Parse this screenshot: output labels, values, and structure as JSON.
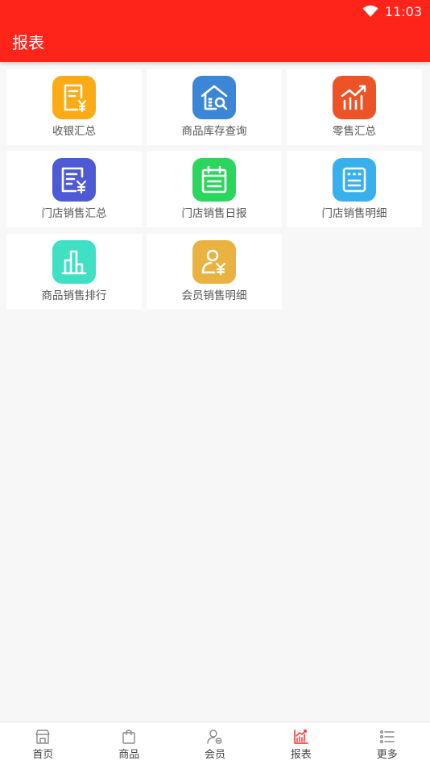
{
  "status_bar": {
    "time": "11:03",
    "wifi_icon": "wifi-icon"
  },
  "header": {
    "title": "报表",
    "bar_color": "#fe2419"
  },
  "tiles": [
    {
      "label": "收银汇总",
      "icon": "cash-receipt-icon",
      "color": "#fbab16"
    },
    {
      "label": "商品库存查询",
      "icon": "warehouse-search-icon",
      "color": "#3b86d6"
    },
    {
      "label": "零售汇总",
      "icon": "chart-trend-icon",
      "color": "#ec5428"
    },
    {
      "label": "门店销售汇总",
      "icon": "store-sales-summary-icon",
      "color": "#4e59d6"
    },
    {
      "label": "门店销售日报",
      "icon": "calendar-icon",
      "color": "#2bd65e"
    },
    {
      "label": "门店销售明细",
      "icon": "detail-list-icon",
      "color": "#36b1ee"
    },
    {
      "label": "商品销售排行",
      "icon": "ranking-bars-icon",
      "color": "#3fe0c4"
    },
    {
      "label": "会员销售明细",
      "icon": "member-yen-icon",
      "color": "#eab341"
    }
  ],
  "bottom_nav": [
    {
      "label": "首页",
      "icon": "store-icon",
      "active": false
    },
    {
      "label": "商品",
      "icon": "bag-icon",
      "active": false
    },
    {
      "label": "会员",
      "icon": "member-icon",
      "active": false
    },
    {
      "label": "报表",
      "icon": "report-chart-icon",
      "active": true,
      "color": "#fe2419"
    },
    {
      "label": "更多",
      "icon": "list-icon",
      "active": false
    }
  ]
}
